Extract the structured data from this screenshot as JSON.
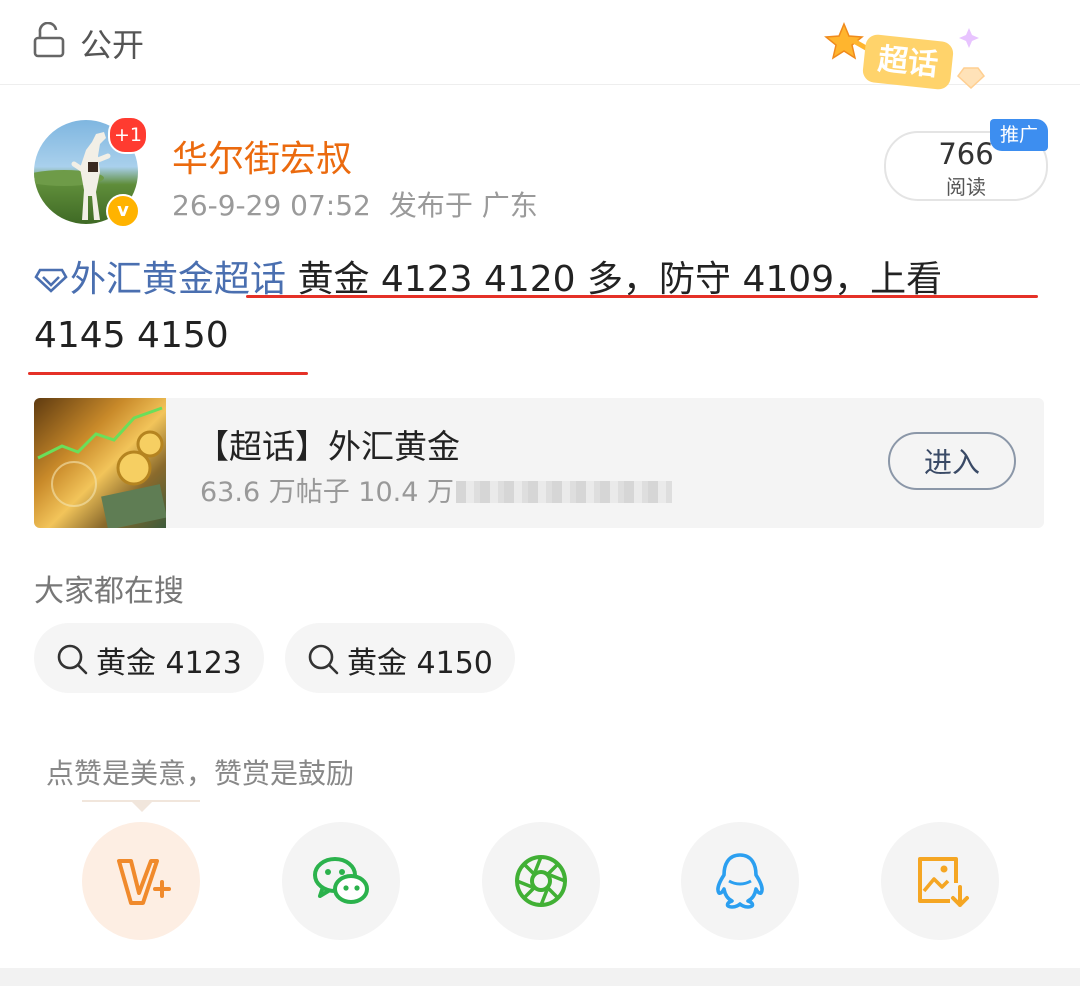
{
  "header": {
    "visibility_label": "公开",
    "lock_icon": "lock-icon",
    "badge_text": "超话"
  },
  "author": {
    "name": "华尔街宏叔",
    "notification_badge": "+1",
    "verified_badge": "v",
    "timestamp": "26-9-29 07:52",
    "location": "发布于 广东"
  },
  "stats": {
    "read_count": "766",
    "read_label": "阅读",
    "promo_tag": "推广"
  },
  "post": {
    "topic": "外汇黄金超话",
    "text_line1": "黄金 4123  4120 多，防守 4109，上看",
    "text_line2": "4145  4150"
  },
  "topic_card": {
    "title": "【超话】外汇黄金",
    "subtitle": "63.6 万帖子 10.4 万",
    "enter_label": "进入"
  },
  "search": {
    "title": "大家都在搜",
    "items": [
      "黄金 4123",
      "黄金 4150"
    ]
  },
  "tip": "点赞是美意，赞赏是鼓励",
  "share": [
    {
      "icon": "weibo-v-plus-icon",
      "color": "#f08a2c"
    },
    {
      "icon": "wechat-icon",
      "color": "#2bb24c"
    },
    {
      "icon": "moments-icon",
      "color": "#41b035"
    },
    {
      "icon": "qq-icon",
      "color": "#2b9ff0"
    },
    {
      "icon": "save-image-icon",
      "color": "#f5a623"
    }
  ],
  "colors": {
    "accent_orange": "#eb6a0e",
    "topic_blue": "#4a6fb0",
    "underline_red": "#e53127",
    "promo_blue": "#3d8ef0"
  }
}
